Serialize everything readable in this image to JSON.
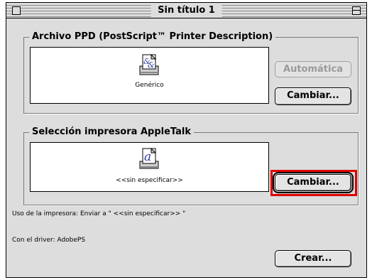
{
  "window": {
    "title": "Sin título 1"
  },
  "ppd": {
    "group_label": "Archivo PPD (PostScript™ Printer Description)",
    "icon": "generic-printer-driver-icon",
    "caption": "Genérico",
    "auto_button": "Automática",
    "change_button": "Cambiar..."
  },
  "printer": {
    "group_label": "Selección impresora AppleTalk",
    "icon": "laserwriter-printer-icon",
    "caption": "<<sin especificar>>",
    "change_button": "Cambiar..."
  },
  "info": {
    "usage": "Uso de la impresora: Enviar a \" <<sin especificar>> \"",
    "driver": "Con el driver: AdobePS"
  },
  "create_button": "Crear...",
  "colors": {
    "highlight": "#e00000",
    "window_bg": "#dddddd"
  }
}
